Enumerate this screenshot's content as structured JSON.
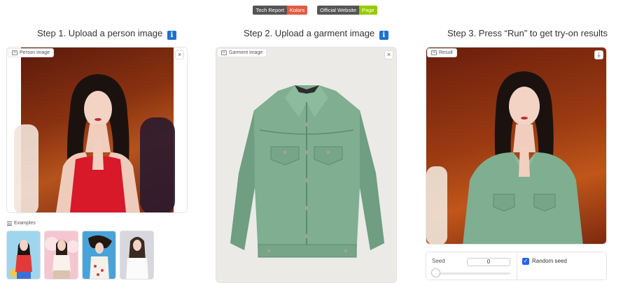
{
  "badges": [
    {
      "left": "Tech Report",
      "right": "Kolors",
      "color": "#e05d44"
    },
    {
      "left": "Official Website",
      "right": "Page",
      "color": "#97ca00"
    }
  ],
  "steps": {
    "step1": "Step 1. Upload a person image",
    "step2": "Step 2. Upload a garment image",
    "step3": "Step 3. Press “Run” to get try-on results",
    "info_glyph": "i"
  },
  "panels": {
    "person_label": "Person image",
    "garment_label": "Garment image",
    "result_label": "Result",
    "close_glyph": "×",
    "download_glyph": "⤓"
  },
  "examples": {
    "label": "Examples",
    "thumbs": [
      "example-1",
      "example-2",
      "example-3",
      "example-4"
    ]
  },
  "seed": {
    "label": "Seed",
    "value": "0",
    "slider_value": 0,
    "random_seed_label": "Random seed",
    "random_seed_checked": true,
    "check_glyph": "✓"
  },
  "colors": {
    "accent": "#2563eb",
    "info_icon": "#1f6fd1",
    "garment": "#7fae91"
  }
}
